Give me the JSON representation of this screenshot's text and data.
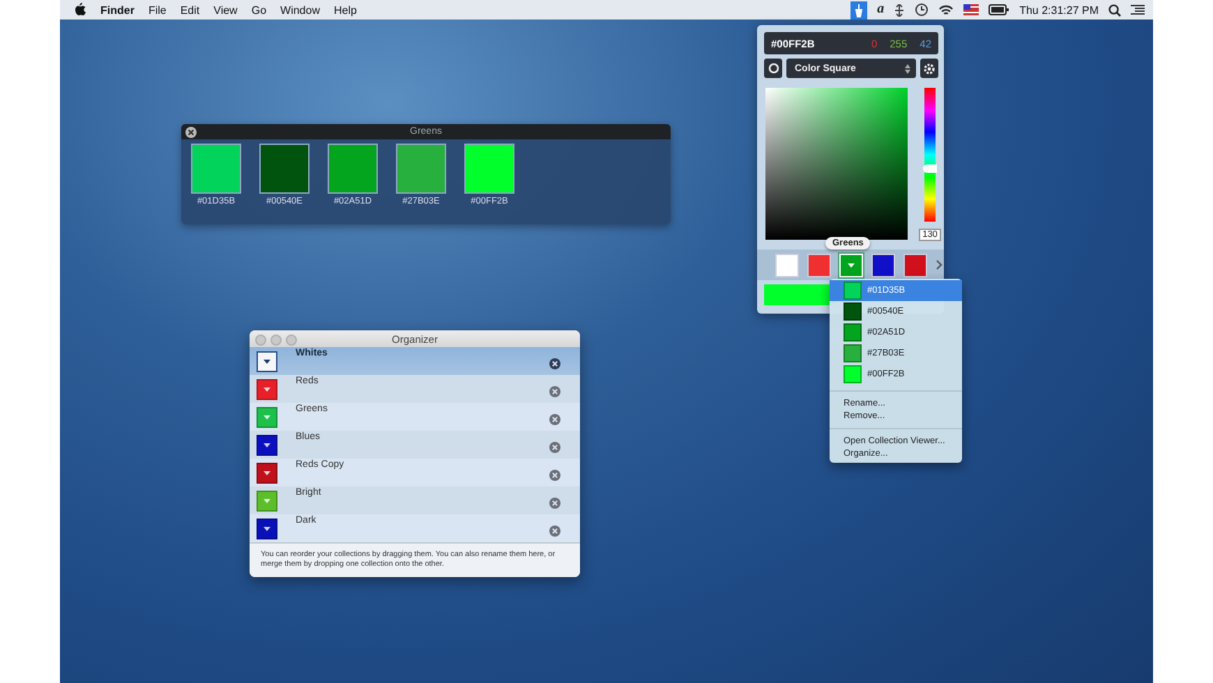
{
  "menubar": {
    "app": "Finder",
    "menus": [
      "File",
      "Edit",
      "View",
      "Go",
      "Window",
      "Help"
    ],
    "glyph": "a",
    "clock": "Thu 2:31:27 PM"
  },
  "greens_window": {
    "title": "Greens",
    "swatches": [
      {
        "label": "#01D35B",
        "color": "#01d35b"
      },
      {
        "label": "#00540E",
        "color": "#00540e"
      },
      {
        "label": "#02A51D",
        "color": "#02a51d"
      },
      {
        "label": "#27B03E",
        "color": "#27b03e"
      },
      {
        "label": "#00FF2B",
        "color": "#00ff2b"
      }
    ]
  },
  "color_picker": {
    "hex": "#00FF2B",
    "red": "0",
    "green": "255",
    "blue": "42",
    "mode": "Color Square",
    "hue": {
      "level": 0.4
    },
    "brightness": "130",
    "tooltip": "Greens",
    "current_swatch": {
      "color": "#00ff2b"
    },
    "swatches": [
      {
        "color": "#ffffff",
        "selected": false
      },
      {
        "color": "#f03030",
        "selected": false
      },
      {
        "color": "#02a51d",
        "selected": true
      },
      {
        "color": "#1010c8",
        "selected": false
      },
      {
        "color": "#d0101c",
        "selected": false
      }
    ]
  },
  "collection_menu": {
    "colors": [
      {
        "label": "#01D35B",
        "color": "#01d35b",
        "selected": true
      },
      {
        "label": "#00540E",
        "color": "#00540e",
        "selected": false
      },
      {
        "label": "#02A51D",
        "color": "#02a51d",
        "selected": false
      },
      {
        "label": "#27B03E",
        "color": "#27b03e",
        "selected": false
      },
      {
        "label": "#00FF2B",
        "color": "#00ff2b",
        "selected": false
      }
    ],
    "actions": [
      "Rename...",
      "Remove..."
    ],
    "more": [
      "Open Collection Viewer...",
      "Organize..."
    ]
  },
  "organizer": {
    "title": "Organizer",
    "rows": [
      {
        "name": "Whites",
        "color": "#f4f6f8",
        "selected": true
      },
      {
        "name": "Reds",
        "color": "#e8202a",
        "selected": false
      },
      {
        "name": "Greens",
        "color": "#1cc04a",
        "selected": false
      },
      {
        "name": "Blues",
        "color": "#0a10c0",
        "selected": false
      },
      {
        "name": "Reds Copy",
        "color": "#c0101c",
        "selected": false
      },
      {
        "name": "Bright",
        "color": "#5cbf2a",
        "selected": false
      },
      {
        "name": "Dark",
        "color": "#0a10b8",
        "selected": false
      }
    ],
    "footer": "You can reorder your collections by dragging them. You can also rename them here, or merge them by dropping one collection onto the other."
  }
}
